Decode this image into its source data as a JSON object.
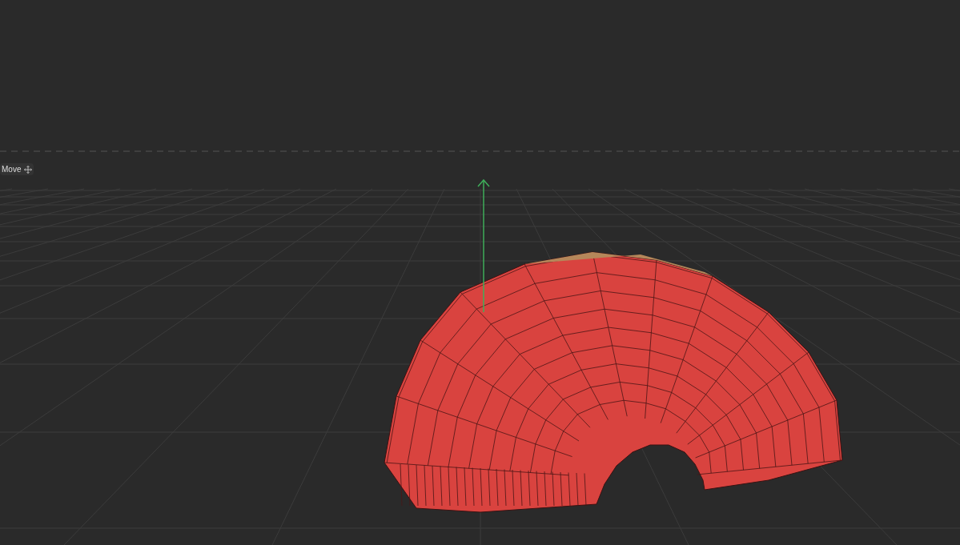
{
  "viewport": {
    "tool_label": "Move"
  }
}
